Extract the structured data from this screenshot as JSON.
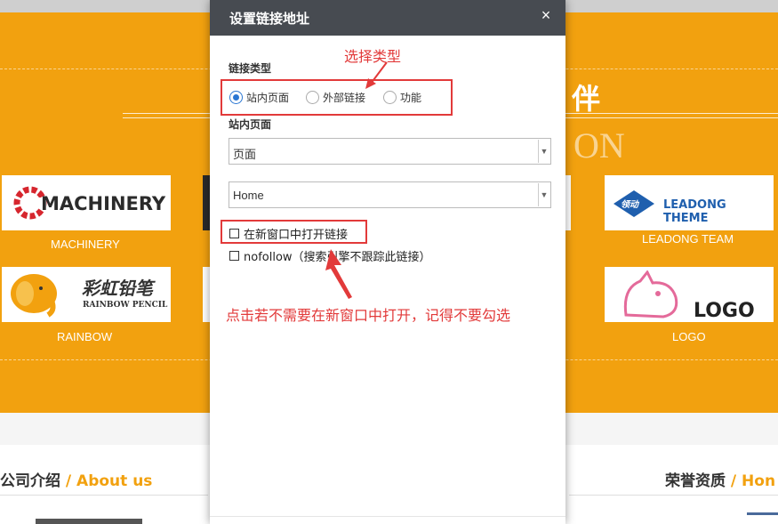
{
  "background": {
    "title_glyph": "伴",
    "subtitle_partial": "ON",
    "logos": [
      {
        "logo_text": "MACHINERY",
        "caption": "MACHINERY"
      },
      {
        "logo_text_cn": "彩虹铅笔",
        "logo_text_en": "RAINBOW PENCIL",
        "caption": "RAINBOW"
      },
      {
        "logo_text_cn": "领动",
        "logo_text": "LEADONG THEME",
        "caption": "LEADONG TEAM"
      },
      {
        "logo_text": "LOGO",
        "caption": "LOGO"
      }
    ],
    "section_left": {
      "cn": "公司介绍",
      "sep": " / ",
      "en": "About us"
    },
    "section_right": {
      "cn": "荣誉资质",
      "sep": " / ",
      "en": "Hon"
    }
  },
  "modal": {
    "title": "设置链接地址",
    "close_glyph": "×",
    "link_type_label": "链接类型",
    "link_types": [
      {
        "label": "站内页面",
        "selected": true
      },
      {
        "label": "外部链接",
        "selected": false
      },
      {
        "label": "功能",
        "selected": false
      }
    ],
    "site_page_label": "站内页面",
    "select_type_value": "页面",
    "select_page_value": "Home",
    "open_new_window_label": "在新窗口中打开链接",
    "nofollow_label": "nofollow（搜索引擎不跟踪此链接）"
  },
  "annotations": {
    "select_type": "选择类型",
    "note": "点击若不需要在新窗口中打开，记得不要勾选",
    "color": "#e23a3a"
  },
  "colors": {
    "orange": "#f2a10f",
    "header": "#474b51",
    "radio_accent": "#2a76d2"
  }
}
